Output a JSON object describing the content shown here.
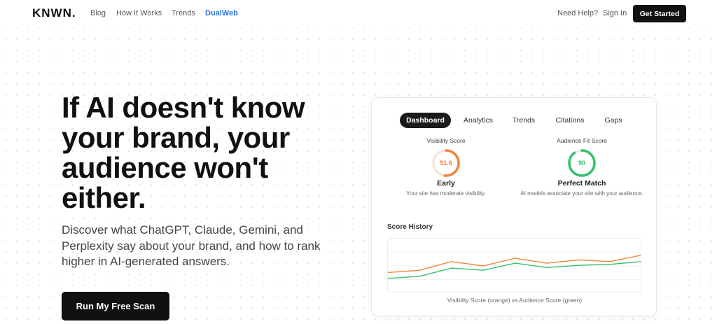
{
  "nav": {
    "logo": "KNWN.",
    "links": [
      "Blog",
      "How It Works",
      "Trends",
      "DualWeb"
    ],
    "need_help": "Need Help?",
    "sign_in": "Sign In",
    "get_started": "Get Started"
  },
  "hero": {
    "title_lines": [
      "If AI doesn't know",
      "your brand, your",
      "audience won't",
      "either."
    ],
    "subtitle": "Discover what ChatGPT, Claude, Gemini, and Perplexity say about your brand, and how to rank higher in AI-generated answers.",
    "cta": "Run My Free Scan"
  },
  "dashboard": {
    "tabs": [
      "Dashboard",
      "Analytics",
      "Trends",
      "Citations",
      "Gaps"
    ],
    "active_tab": "Dashboard",
    "visibility": {
      "label": "Visibility Score",
      "value": "51.6",
      "status": "Early",
      "description": "Your site has moderate visibility.",
      "color": "#f2843b"
    },
    "audience": {
      "label": "Audience Fit Score",
      "value": "90",
      "status": "Perfect Match",
      "description": "AI models associate your site with your audience.",
      "color": "#37c06a"
    },
    "history": {
      "title": "Score History",
      "caption": "Visibility Score (orange) vs Audience Score (green)",
      "orange_series": [
        38,
        42,
        58,
        50,
        64,
        55,
        61,
        58,
        70
      ],
      "green_series": [
        27,
        31,
        46,
        42,
        55,
        47,
        51,
        53,
        58
      ],
      "orange_color": "#f2843b",
      "green_color": "#37c06a"
    }
  }
}
